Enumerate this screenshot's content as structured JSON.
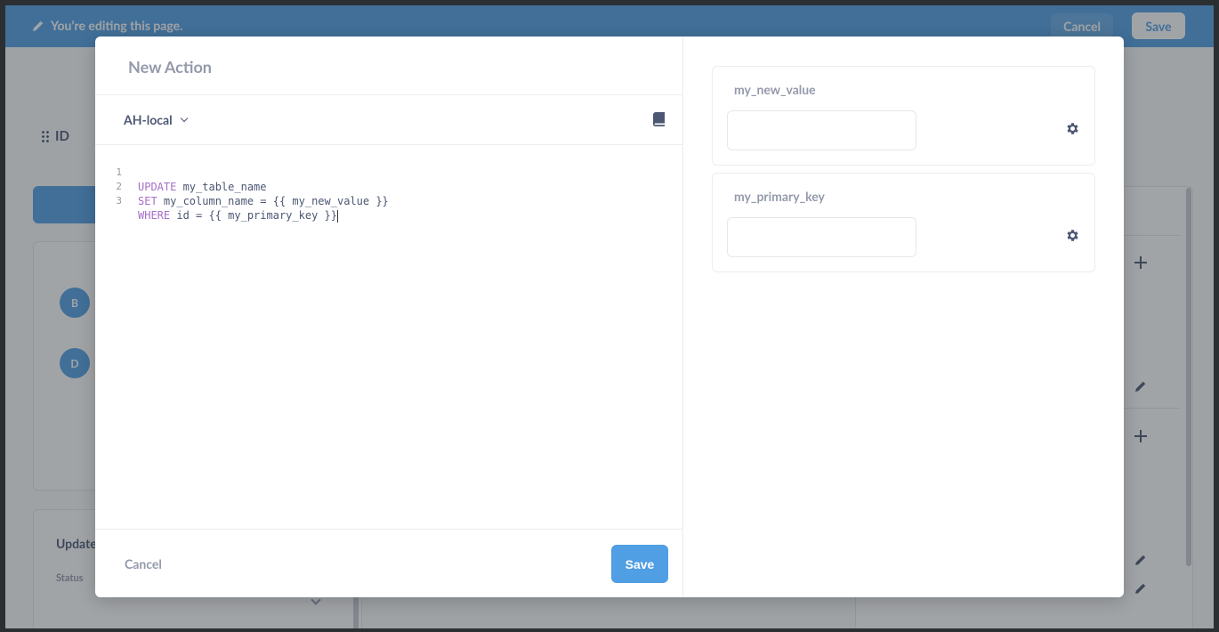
{
  "background": {
    "edit_message": "You’re editing this page.",
    "cancel_label": "Cancel",
    "save_label": "Save",
    "id_label": "ID",
    "avatars": [
      "B",
      "D"
    ],
    "update_title": "Update",
    "status_label": "Status"
  },
  "modal": {
    "title": "New Action",
    "database": "AH-local",
    "editor": {
      "lines": [
        {
          "number": "1",
          "keyword": "UPDATE",
          "rest": " my_table_name"
        },
        {
          "number": "2",
          "keyword": "SET",
          "rest": " my_column_name = {{ my_new_value }}"
        },
        {
          "number": "3",
          "keyword": "WHERE",
          "rest": " id = {{ my_primary_key }}"
        }
      ]
    },
    "cancel_label": "Cancel",
    "save_label": "Save",
    "parameters": [
      {
        "name": "my_new_value",
        "value": ""
      },
      {
        "name": "my_primary_key",
        "value": ""
      }
    ]
  },
  "colors": {
    "brand": "#509ee3",
    "text_dark": "#4c5773",
    "text_light": "#949aab",
    "keyword": "#a66fc9"
  }
}
